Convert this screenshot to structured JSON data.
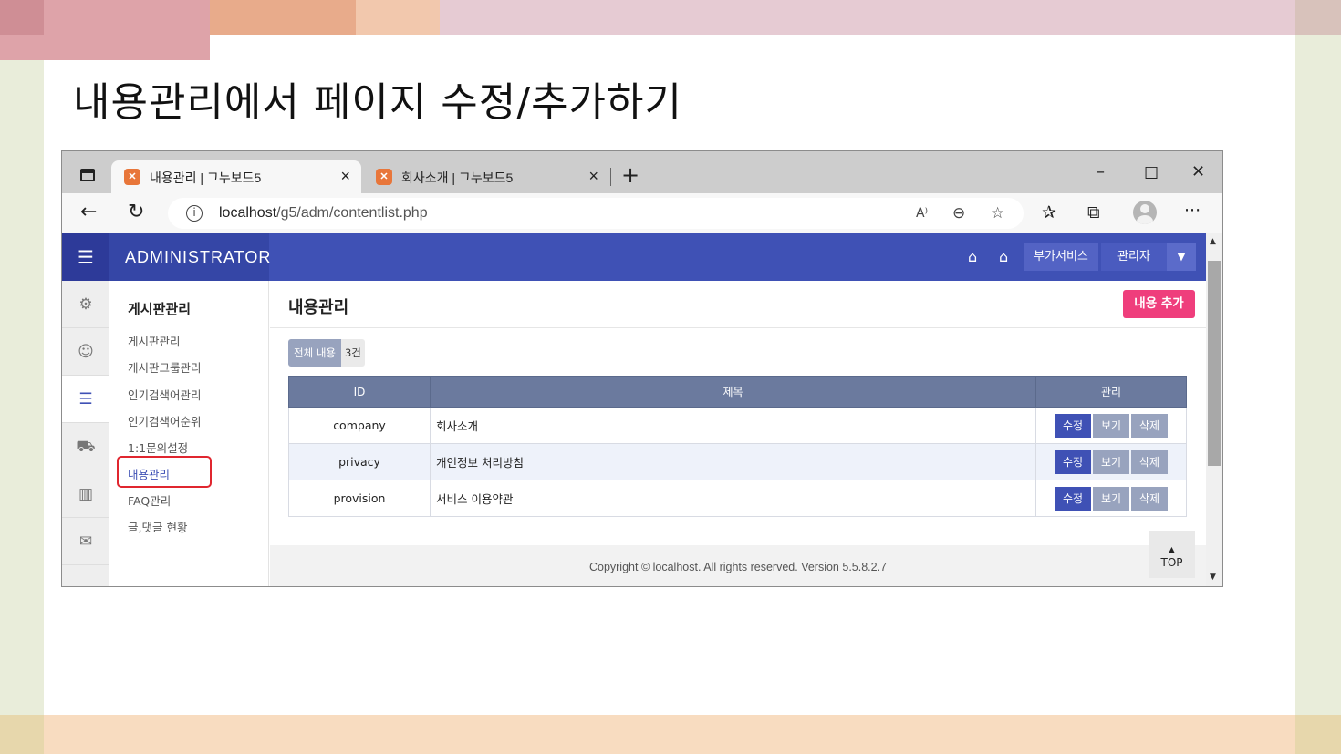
{
  "slide": {
    "title": "내용관리에서 페이지 수정/추가하기"
  },
  "browser": {
    "tabs": [
      {
        "label": "내용관리 | 그누보드5",
        "icon": "xampp-icon",
        "active": true
      },
      {
        "label": "회사소개 | 그누보드5",
        "icon": "xampp-icon",
        "active": false
      }
    ],
    "url_host": "localhost",
    "url_path": "/g5/adm/contentlist.php"
  },
  "admin": {
    "brand": "ADMINISTRATOR",
    "header_buttons": {
      "addon": "부가서비스",
      "admin": "관리자"
    },
    "iconbar": [
      "gear-icon",
      "user-icon",
      "list-icon",
      "cart-icon",
      "chart-icon",
      "mail-icon"
    ],
    "submenu": {
      "heading": "게시판관리",
      "items": [
        "게시판관리",
        "게시판그룹관리",
        "인기검색어관리",
        "인기검색어순위",
        "1:1문의설정",
        "내용관리",
        "FAQ관리",
        "글,댓글 현황"
      ],
      "active_index": 5
    },
    "main": {
      "title": "내용관리",
      "add_button": "내용 추가",
      "count_label": "전체 내용",
      "count_value": "3건",
      "columns": [
        "ID",
        "제목",
        "관리"
      ],
      "rows": [
        {
          "id": "company",
          "subject": "회사소개"
        },
        {
          "id": "privacy",
          "subject": "개인정보 처리방침"
        },
        {
          "id": "provision",
          "subject": "서비스 이용약관"
        }
      ],
      "row_actions": {
        "edit": "수정",
        "view": "보기",
        "delete": "삭제"
      }
    },
    "footer": "Copyright © localhost. All rights reserved. Version 5.5.8.2.7",
    "top_button": "TOP"
  },
  "colors": {
    "header": "#3f51b5",
    "accent_pink": "#ef3e7c",
    "highlight_red": "#e0262f"
  }
}
